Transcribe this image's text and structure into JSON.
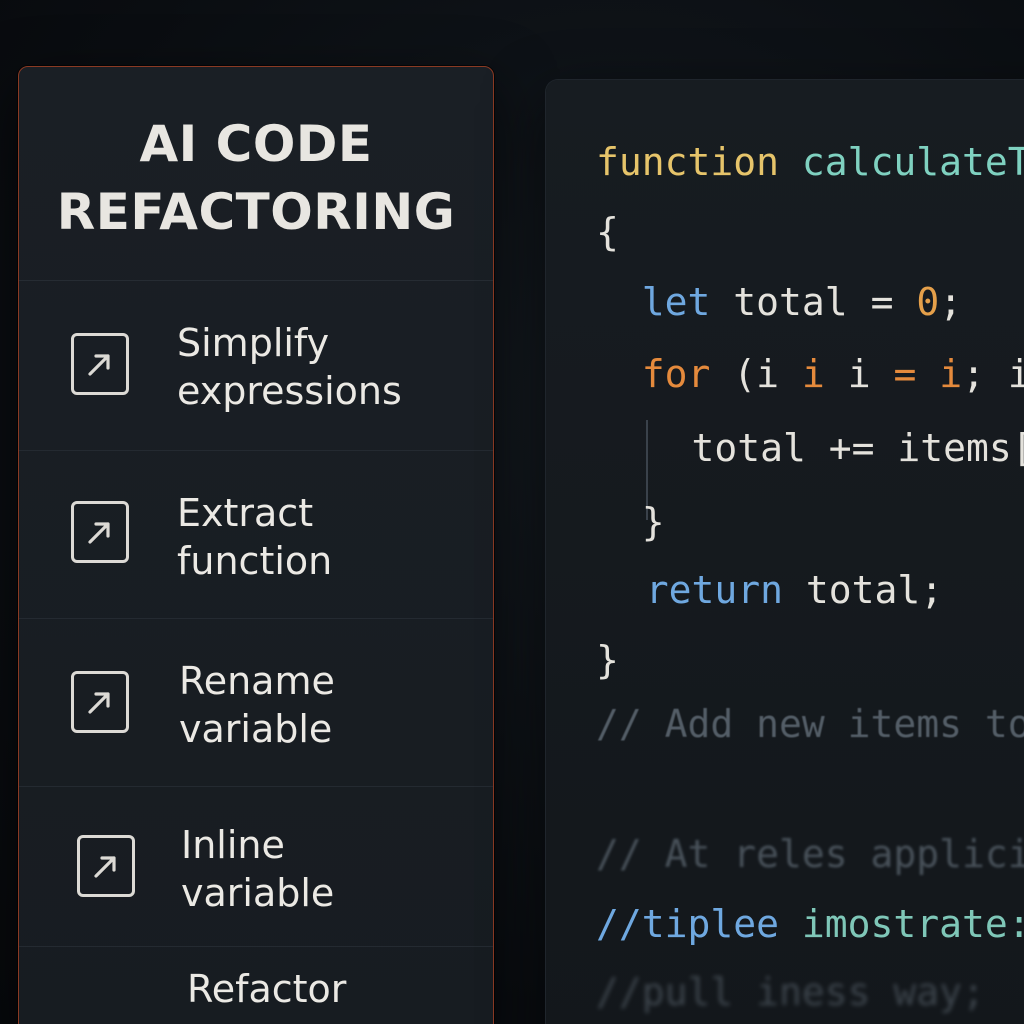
{
  "panel": {
    "title": "AI CODE\nREFACTORING",
    "actions": [
      {
        "label": "Simplify\nexpressions",
        "icon": "arrow-up-right-icon"
      },
      {
        "label": "Extract\nfunction",
        "icon": "arrow-up-right-icon"
      },
      {
        "label": "Rename\nvariable",
        "icon": "arrow-up-right-icon"
      },
      {
        "label": "Inline\nvariable",
        "icon": "arrow-up-right-icon"
      },
      {
        "label": "Refactor"
      }
    ]
  },
  "editor": {
    "lines": [
      {
        "tokens": [
          {
            "t": "function ",
            "c": "kw-yellow"
          },
          {
            "t": "calculateTotal",
            "c": "fn-teal"
          }
        ]
      },
      {
        "tokens": [
          {
            "t": "{",
            "c": "plain"
          }
        ]
      },
      {
        "tokens": [
          {
            "t": "  let ",
            "c": "kw-blue"
          },
          {
            "t": "total ",
            "c": "plain"
          },
          {
            "t": "= ",
            "c": "plain"
          },
          {
            "t": "0",
            "c": "num-orange"
          },
          {
            "t": ";",
            "c": "plain"
          }
        ]
      },
      {
        "tokens": [
          {
            "t": "  for ",
            "c": "kw-orange"
          },
          {
            "t": "(i ",
            "c": "plain"
          },
          {
            "t": "i ",
            "c": "kw-orange"
          },
          {
            "t": "i ",
            "c": "plain"
          },
          {
            "t": "= ",
            "c": "kw-orange"
          },
          {
            "t": "i",
            "c": "kw-orange"
          },
          {
            "t": "; items",
            "c": "plain"
          }
        ]
      },
      {
        "tokens": [
          {
            "t": "    total += items[i];",
            "c": "plain"
          }
        ]
      },
      {
        "tokens": [
          {
            "t": "  }",
            "c": "plain"
          }
        ]
      },
      {
        "tokens": [
          {
            "t": "  return ",
            "c": "kw-blue"
          },
          {
            "t": "total;",
            "c": "plain"
          }
        ]
      },
      {
        "tokens": [
          {
            "t": "}",
            "c": "plain"
          }
        ]
      },
      {
        "tokens": [
          {
            "t": "// Add new items to",
            "c": "comment"
          }
        ]
      },
      {
        "tokens": [
          {
            "t": "// At reles applicin",
            "c": "comment"
          }
        ]
      },
      {
        "tokens": [
          {
            "t": "//tiplee ",
            "c": "kw-blue"
          },
          {
            "t": "imostrate:",
            "c": "comment-teal"
          }
        ]
      },
      {
        "tokens": [
          {
            "t": "//pull iness way;",
            "c": "comment"
          }
        ]
      }
    ]
  },
  "colors": {
    "panel_border": "#8a3a24",
    "background": "#0b0f13",
    "keyword_yellow": "#e6c46a",
    "function_teal": "#7fd1c0",
    "keyword_blue": "#6fa8e0",
    "keyword_orange": "#e58a3c",
    "comment": "#5f6a74"
  }
}
